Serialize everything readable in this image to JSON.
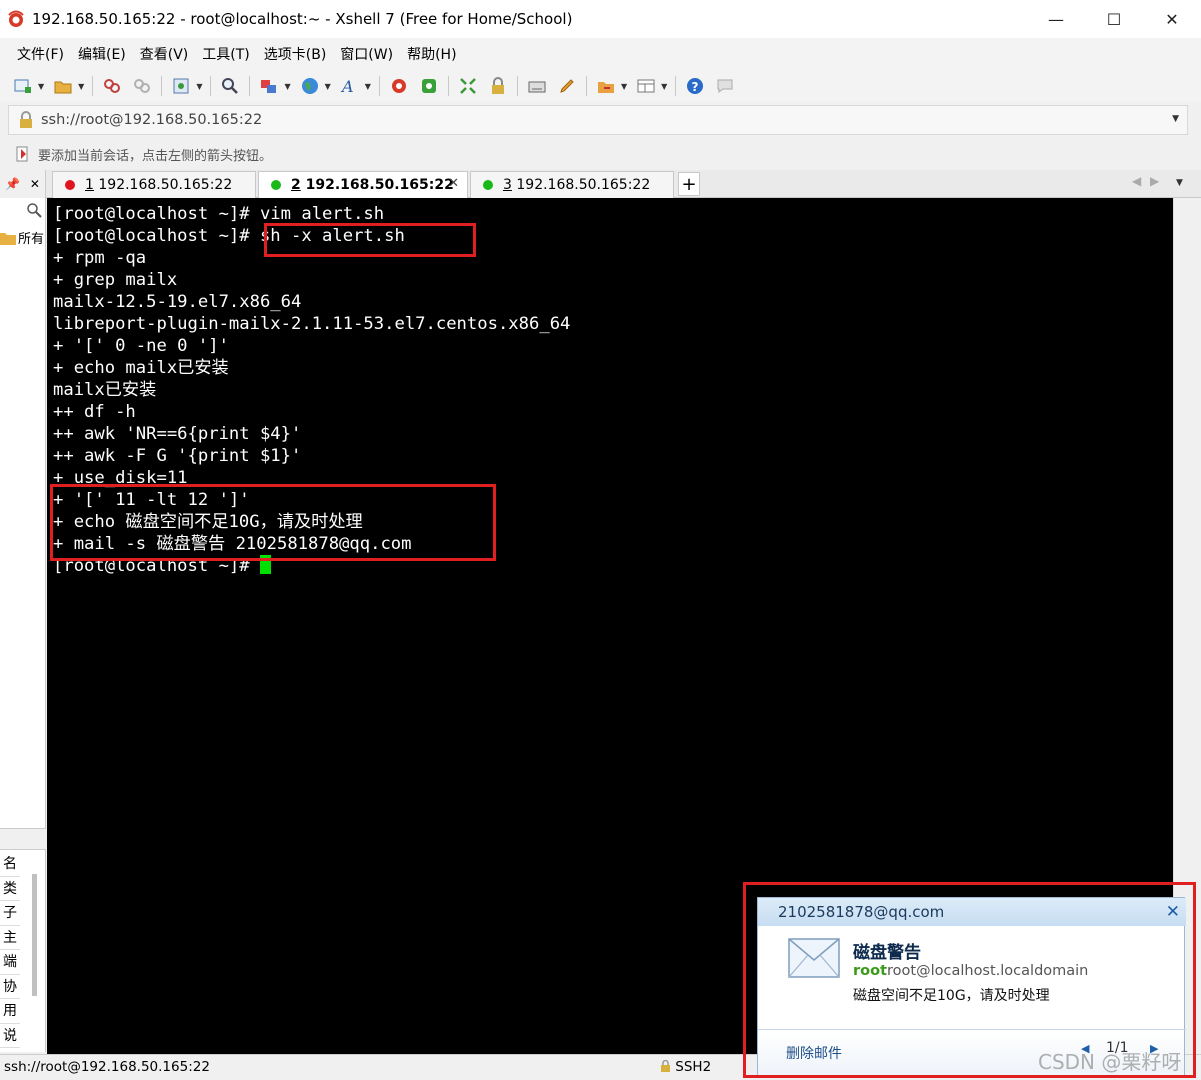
{
  "window": {
    "title": "192.168.50.165:22 - root@localhost:~ - Xshell 7 (Free for Home/School)",
    "minimize": "—",
    "maximize": "☐",
    "close": "✕"
  },
  "menu": [
    "文件(F)",
    "编辑(E)",
    "查看(V)",
    "工具(T)",
    "选项卡(B)",
    "窗口(W)",
    "帮助(H)"
  ],
  "address": {
    "value": "ssh://root@192.168.50.165:22"
  },
  "hint": {
    "text": "要添加当前会话，点击左侧的箭头按钮。"
  },
  "tabs": [
    {
      "num": "1",
      "label": "192.168.50.165:22",
      "color": "#e0141e",
      "active": false
    },
    {
      "num": "2",
      "label": "192.168.50.165:22",
      "color": "#1ab91a",
      "active": true
    },
    {
      "num": "3",
      "label": "192.168.50.165:22",
      "color": "#1ab91a",
      "active": false
    }
  ],
  "tab_close": "✕",
  "tab_add": "+",
  "left_pane": {
    "folder_label": "所有",
    "props": [
      "名",
      "类",
      "子",
      "主",
      "端",
      "协",
      "用",
      "说"
    ]
  },
  "terminal": {
    "lines": [
      "[root@localhost ~]# vim alert.sh",
      "[root@localhost ~]# sh -x alert.sh",
      "+ rpm -qa",
      "+ grep mailx",
      "mailx-12.5-19.el7.x86_64",
      "libreport-plugin-mailx-2.1.11-53.el7.centos.x86_64",
      "+ '[' 0 -ne 0 ']'",
      "+ echo mailx已安装",
      "mailx已安装",
      "++ df -h",
      "++ awk 'NR==6{print $4}'",
      "++ awk -F G '{print $1}'",
      "+ use_disk=11",
      "+ '[' 11 -lt 12 ']'",
      "+ echo 磁盘空间不足10G，请及时处理",
      "+ mail -s 磁盘警告 2102581878@qq.com",
      "[root@localhost ~]# "
    ]
  },
  "status": {
    "connection": "ssh://root@192.168.50.165:22",
    "protocol": "SSH2"
  },
  "notification": {
    "from": "2102581878@qq.com",
    "subject": "磁盘警告",
    "sender_name": "root",
    "sender_addr": "root@localhost.localdomain",
    "body": "磁盘空间不足10G，请及时处理",
    "delete": "删除邮件",
    "count": "1/1",
    "close": "✕"
  },
  "watermark": "CSDN @栗籽呀"
}
